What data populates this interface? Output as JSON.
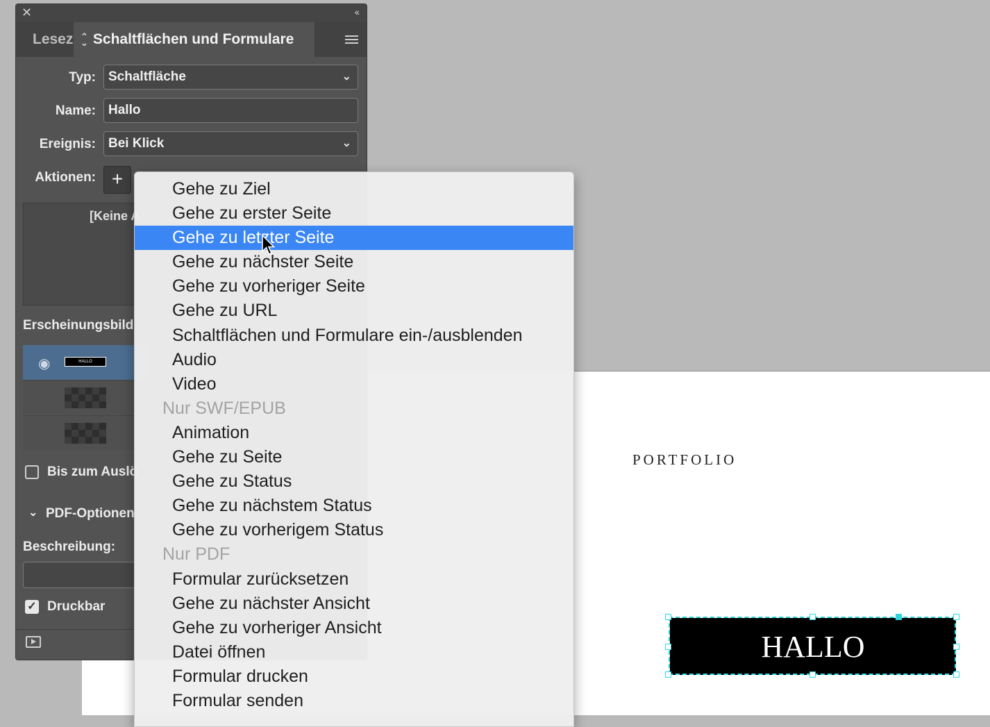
{
  "panel": {
    "tabs": [
      {
        "label": "Lesez"
      },
      {
        "label": "Schaltflächen und Formulare"
      }
    ],
    "type_label": "Typ:",
    "type_value": "Schaltfläche",
    "name_label": "Name:",
    "name_value": "Hallo",
    "event_label": "Ereignis:",
    "event_value": "Bei Klick",
    "actions_label": "Aktionen:",
    "actions_empty": "[Keine A",
    "appearance_label": "Erscheinungsbild",
    "thumb_text": "HALLO",
    "hide_until_label": "Bis zum Auslö",
    "pdf_options_label": "PDF-Optionen",
    "description_label": "Beschreibung:",
    "printable_label": "Druckbar",
    "printable_checked": true,
    "hide_until_checked": false
  },
  "menu": {
    "items": [
      {
        "label": "Gehe zu Ziel",
        "kind": "item"
      },
      {
        "label": "Gehe zu erster Seite",
        "kind": "item"
      },
      {
        "label": "Gehe zu letzter Seite",
        "kind": "highlighted"
      },
      {
        "label": "Gehe zu nächster Seite",
        "kind": "item"
      },
      {
        "label": "Gehe zu vorheriger Seite",
        "kind": "item"
      },
      {
        "label": "Gehe zu URL",
        "kind": "item"
      },
      {
        "label": "Schaltflächen und Formulare ein-/ausblenden",
        "kind": "item"
      },
      {
        "label": "Audio",
        "kind": "item"
      },
      {
        "label": "Video",
        "kind": "item"
      },
      {
        "label": "Nur SWF/EPUB",
        "kind": "header"
      },
      {
        "label": "Animation",
        "kind": "item"
      },
      {
        "label": "Gehe zu Seite",
        "kind": "item"
      },
      {
        "label": "Gehe zu Status",
        "kind": "item"
      },
      {
        "label": "Gehe zu nächstem Status",
        "kind": "item"
      },
      {
        "label": "Gehe zu vorherigem Status",
        "kind": "item"
      },
      {
        "label": "Nur PDF",
        "kind": "header"
      },
      {
        "label": "Formular zurücksetzen",
        "kind": "item"
      },
      {
        "label": "Gehe zu nächster Ansicht",
        "kind": "item"
      },
      {
        "label": "Gehe zu vorheriger Ansicht",
        "kind": "item"
      },
      {
        "label": "Datei öffnen",
        "kind": "item"
      },
      {
        "label": "Formular drucken",
        "kind": "item"
      },
      {
        "label": "Formular senden",
        "kind": "item"
      }
    ]
  },
  "document": {
    "heading": "PORTFOLIO",
    "button_text": "HALLO"
  },
  "colors": {
    "highlight": "#3a86f4",
    "selection": "#2fd6df",
    "panel_bg": "#535353"
  }
}
